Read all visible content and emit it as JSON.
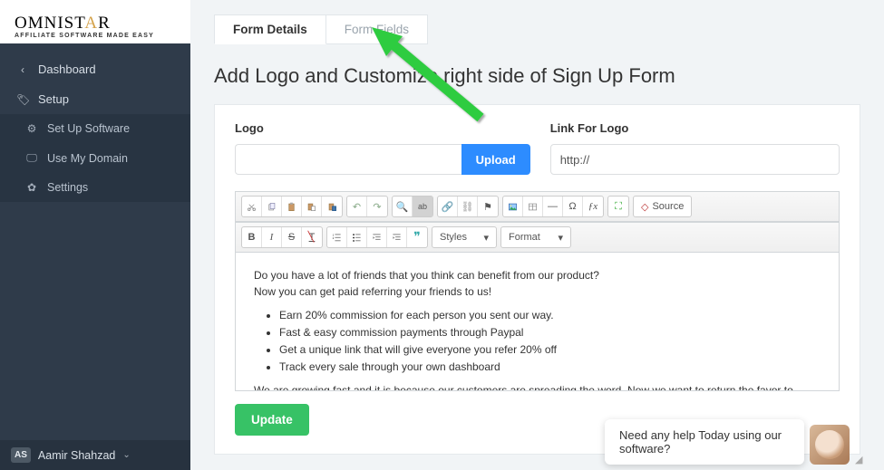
{
  "logo": {
    "big_a": "OMNIST",
    "big_b": "R",
    "star": "A",
    "sub": "AFFILIATE SOFTWARE MADE EASY"
  },
  "sidebar": {
    "dashboard": "Dashboard",
    "setup": "Setup",
    "items": [
      {
        "icon": "⚙",
        "label": "Set Up Software"
      },
      {
        "icon": "🖵",
        "label": "Use My Domain"
      },
      {
        "icon": "✿",
        "label": "Settings"
      }
    ]
  },
  "user": {
    "initials": "AS",
    "name": "Aamir Shahzad"
  },
  "tabs": {
    "details": "Form Details",
    "fields": "Form Fields"
  },
  "page_title": "Add Logo and Customize right side of Sign Up Form",
  "logo_section": {
    "label": "Logo",
    "upload": "Upload"
  },
  "link_section": {
    "label": "Link For Logo",
    "value": "http://"
  },
  "toolbar": {
    "styles": "Styles",
    "format": "Format",
    "source": "Source"
  },
  "editor": {
    "p1a": "Do you have a lot of friends that you think can benefit from our product?",
    "p1b": "Now you can get paid referring your friends to us!",
    "li1": "Earn 20% commission for each person you sent our way.",
    "li2": "Fast & easy commission payments through Paypal",
    "li3": "Get a unique link that will give everyone you refer 20% off",
    "li4": "Track every sale through your own dashboard",
    "p2": "We are growing fast and it is because our customers are spreading the word. Now we want to return the favor to everyone that has helped us. Start getting paid today!"
  },
  "update_btn": "Update",
  "chat": {
    "msg": "Need any help Today using our software?"
  }
}
